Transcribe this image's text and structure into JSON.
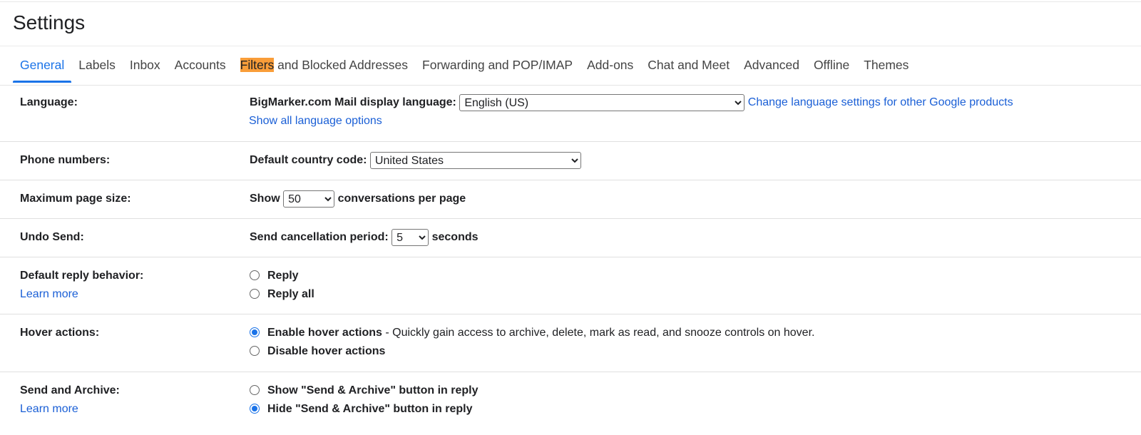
{
  "title": "Settings",
  "tabs": [
    {
      "label": "General",
      "active": true
    },
    {
      "label": "Labels"
    },
    {
      "label": "Inbox"
    },
    {
      "label": "Accounts"
    },
    {
      "label_highlight": "Filters",
      "label_rest": " and Blocked Addresses"
    },
    {
      "label": "Forwarding and POP/IMAP"
    },
    {
      "label": "Add-ons"
    },
    {
      "label": "Chat and Meet"
    },
    {
      "label": "Advanced"
    },
    {
      "label": "Offline"
    },
    {
      "label": "Themes"
    }
  ],
  "highlight_color": "#f99d39",
  "accent_color": "#1a73e8",
  "language": {
    "label": "Language:",
    "field_label": "BigMarker.com Mail display language:",
    "value": "English (US)",
    "change_link": "Change language settings for other Google products",
    "show_all_link": "Show all language options"
  },
  "phone": {
    "label": "Phone numbers:",
    "field_label": "Default country code:",
    "value": "United States"
  },
  "page_size": {
    "label": "Maximum page size:",
    "prefix": "Show",
    "value": "50",
    "suffix": "conversations per page"
  },
  "undo_send": {
    "label": "Undo Send:",
    "field_label": "Send cancellation period:",
    "value": "5",
    "suffix": "seconds"
  },
  "reply": {
    "label": "Default reply behavior:",
    "learn_more": "Learn more",
    "options": [
      {
        "label": "Reply",
        "checked": false
      },
      {
        "label": "Reply all",
        "checked": false
      }
    ]
  },
  "hover": {
    "label": "Hover actions:",
    "options": [
      {
        "label": "Enable hover actions",
        "desc": " - Quickly gain access to archive, delete, mark as read, and snooze controls on hover.",
        "checked": true
      },
      {
        "label": "Disable hover actions",
        "checked": false
      }
    ]
  },
  "send_archive": {
    "label": "Send and Archive:",
    "learn_more": "Learn more",
    "options": [
      {
        "label": "Show \"Send & Archive\" button in reply",
        "checked": false
      },
      {
        "label": "Hide \"Send & Archive\" button in reply",
        "checked": true
      }
    ]
  }
}
